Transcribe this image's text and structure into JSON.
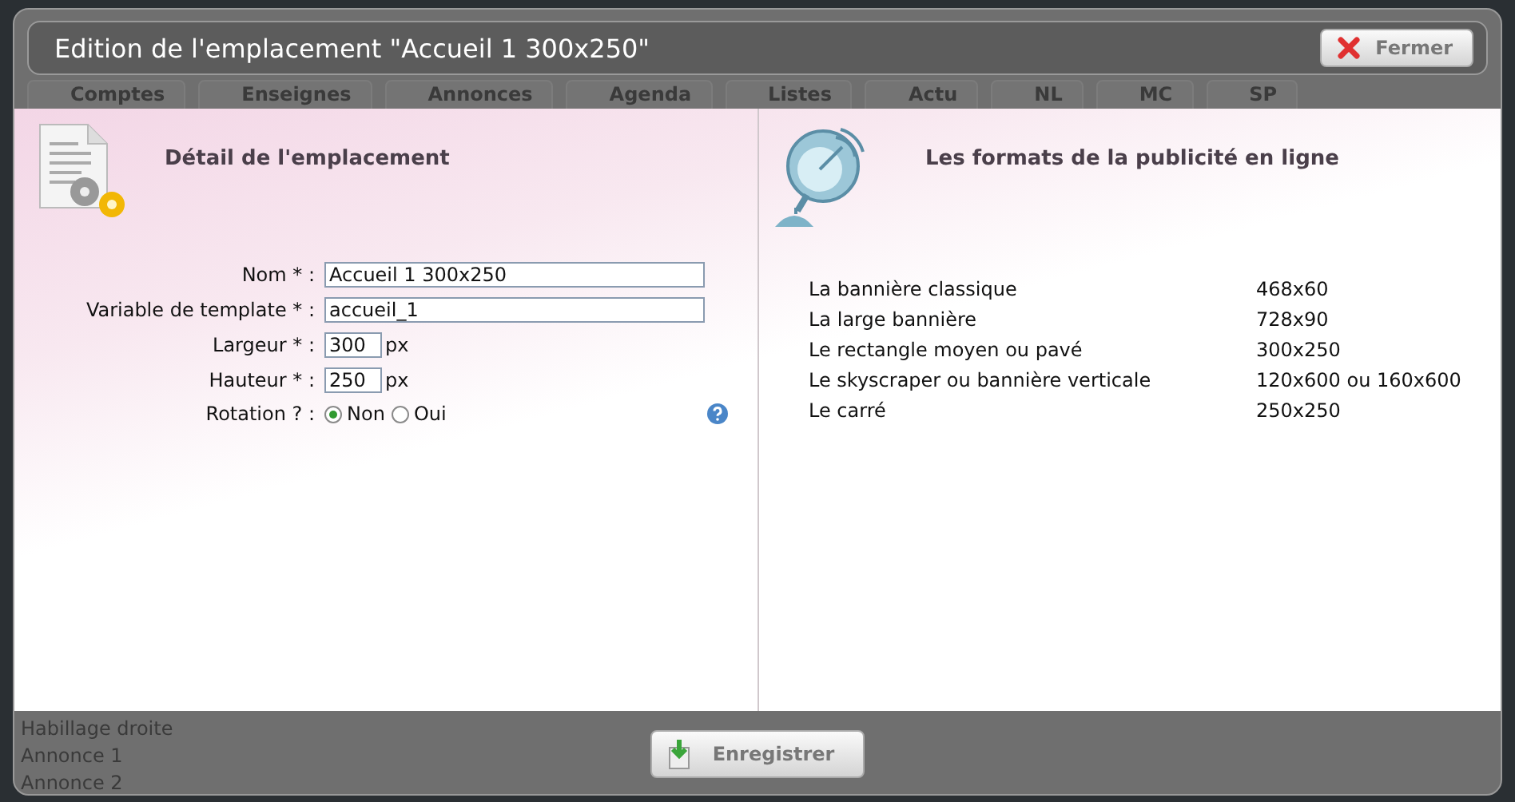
{
  "background_tabs": [
    {
      "label": "Comptes"
    },
    {
      "label": "Enseignes"
    },
    {
      "label": "Annonces"
    },
    {
      "label": "Agenda"
    },
    {
      "label": "Listes"
    },
    {
      "label": "Actu"
    },
    {
      "label": "NL"
    },
    {
      "label": "MC"
    },
    {
      "label": "SP"
    }
  ],
  "background_list": [
    "Habillage droite",
    "Annonce 1",
    "Annonce 2"
  ],
  "dialog": {
    "title": "Edition de l'emplacement \"Accueil 1 300x250\"",
    "close_button": "Fermer"
  },
  "detail": {
    "title": "Détail de l'emplacement",
    "fields": [
      {
        "kind": "text",
        "label": "Nom * :",
        "value": "Accueil 1 300x250"
      },
      {
        "kind": "text",
        "label": "Variable de template * :",
        "value": "accueil_1"
      },
      {
        "kind": "size",
        "label": "Largeur * :",
        "value": "300",
        "unit": "px"
      },
      {
        "kind": "size",
        "label": "Hauteur * :",
        "value": "250",
        "unit": "px"
      },
      {
        "kind": "radio",
        "label": "Rotation ? :",
        "options": [
          {
            "label": "Non",
            "selected": true
          },
          {
            "label": "Oui",
            "selected": false
          }
        ]
      }
    ]
  },
  "formats": {
    "title": "Les formats de la publicité en ligne",
    "rows": [
      {
        "name": "La bannière classique",
        "size": "468x60"
      },
      {
        "name": "La large bannière",
        "size": "728x90"
      },
      {
        "name": "Le rectangle moyen ou pavé",
        "size": "300x250"
      },
      {
        "name": "Le skyscraper ou bannière verticale",
        "size": "120x600 ou 160x600"
      },
      {
        "name": "Le carré",
        "size": "250x250"
      }
    ]
  },
  "save_button": "Enregistrer"
}
